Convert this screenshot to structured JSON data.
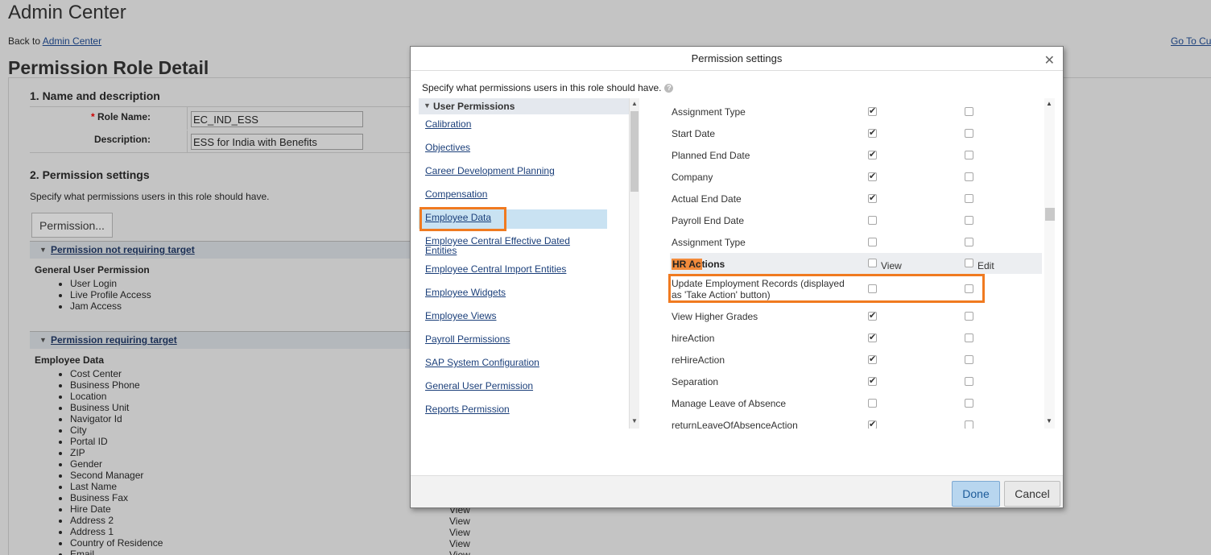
{
  "background": {
    "app_title": "Admin Center",
    "back_prefix": "Back to",
    "back_link": "Admin Center",
    "goto_link": "Go To Cu",
    "page_title": "Permission Role Detail",
    "section1_title": "1. Name and description",
    "role_name_label": "Role Name:",
    "role_name_required": "*",
    "role_name_value": "EC_IND_ESS",
    "description_label": "Description:",
    "description_value": "ESS for India with Benefits",
    "section2_title": "2. Permission settings",
    "section2_desc": "Specify what permissions users in this role should have.",
    "permission_button": "Permission...",
    "bar1_label": "Permission not requiring target",
    "group1_title": "General User Permission",
    "group1_items": [
      "User Login",
      "Live Profile Access",
      "Jam Access"
    ],
    "bar2_label": "Permission requiring target",
    "group2_title": "Employee Data",
    "group2_items": [
      "Cost Center",
      "Business Phone",
      "Location",
      "Business Unit",
      "Navigator Id",
      "City",
      "Portal ID",
      "ZIP",
      "Gender",
      "Second Manager",
      "Last Name",
      "Business Fax",
      "Hire Date",
      "Address 2",
      "Address 1",
      "Country of Residence",
      "Email"
    ],
    "view_column": [
      "View",
      "View",
      "View",
      "View",
      "View"
    ]
  },
  "modal": {
    "title": "Permission settings",
    "description": "Specify what permissions users in this role should have.",
    "left_header": "User Permissions",
    "left_items": [
      "Calibration",
      "Objectives",
      "Career Development Planning",
      "Compensation",
      "Employee Data",
      "Employee Central Effective Dated Entities",
      "Employee Central Import Entities",
      "Employee Widgets",
      "Employee Views",
      "Payroll Permissions",
      "SAP System Configuration",
      "General User Permission",
      "Reports Permission"
    ],
    "selected_item": "Employee Data",
    "rows_top": [
      {
        "label": "Assignment Type",
        "view": true,
        "edit": false
      },
      {
        "label": "Start Date",
        "view": true,
        "edit": false
      },
      {
        "label": "Planned End Date",
        "view": true,
        "edit": false
      },
      {
        "label": "Company",
        "view": true,
        "edit": false
      },
      {
        "label": "Actual End Date",
        "view": true,
        "edit": false
      },
      {
        "label": "Payroll End Date",
        "view": false,
        "edit": false
      },
      {
        "label": "Assignment Type",
        "view": false,
        "edit": false
      }
    ],
    "hr_header": {
      "label_hl": "HR Ac",
      "label_rest": "tions",
      "view": "View",
      "edit": "Edit"
    },
    "rows_bottom": [
      {
        "label": "Update Employment Records (displayed as 'Take Action' button)",
        "view": false,
        "edit": false
      },
      {
        "label": "View Higher Grades",
        "view": true,
        "edit": false
      },
      {
        "label": "hireAction",
        "view": true,
        "edit": false
      },
      {
        "label": "reHireAction",
        "view": true,
        "edit": false
      },
      {
        "label": "Separation",
        "view": true,
        "edit": false
      },
      {
        "label": "Manage Leave of Absence",
        "view": false,
        "edit": false
      },
      {
        "label": "returnLeaveOfAbsenceAction",
        "view": true,
        "edit": false
      }
    ],
    "done_label": "Done",
    "cancel_label": "Cancel"
  },
  "colors": {
    "highlight": "#f07a20",
    "link": "#1b3f7a",
    "selected_row": "#c9e2f2"
  }
}
